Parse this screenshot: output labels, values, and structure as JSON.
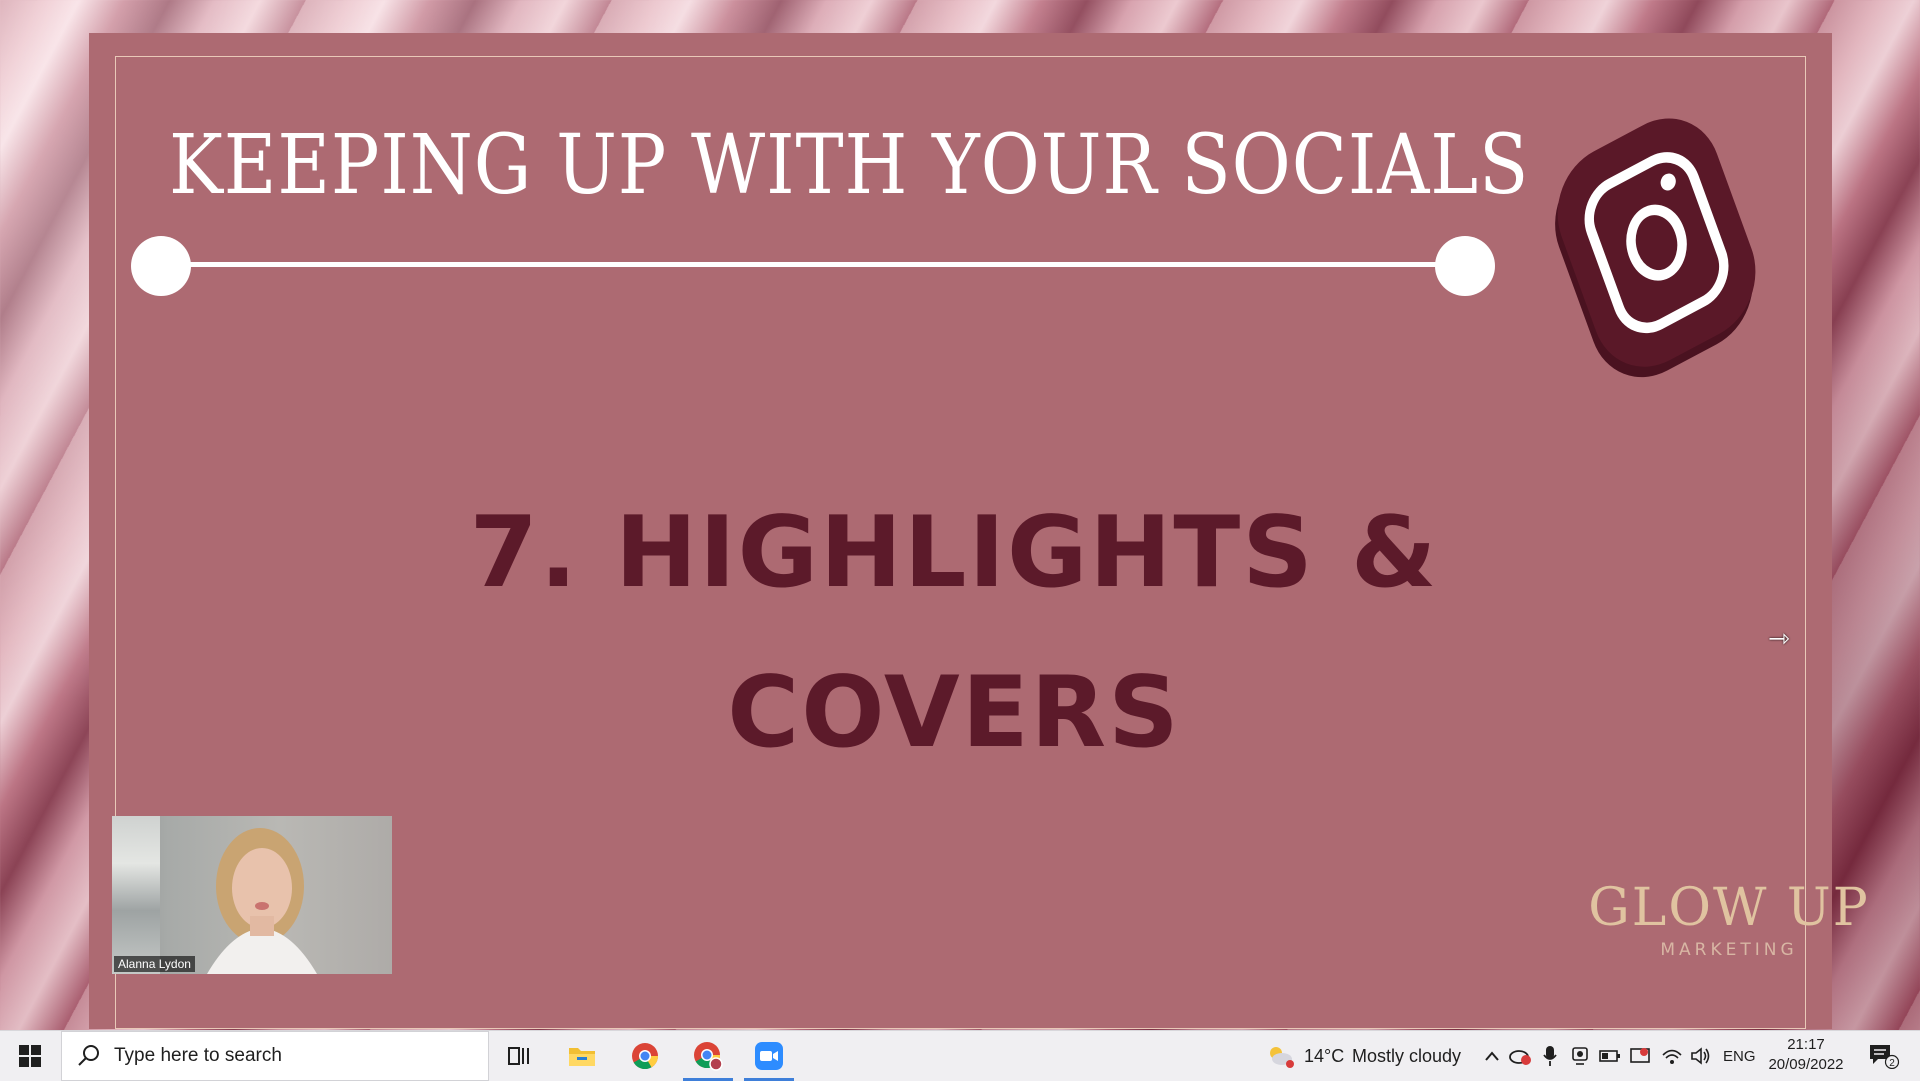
{
  "slide": {
    "title": "KEEPING UP WITH YOUR SOCIALS",
    "heading_line1": "7. HIGHLIGHTS &",
    "heading_line2": "COVERS",
    "brand_name": "GLOW UP",
    "brand_sub": "MARKETING",
    "icon": "instagram-icon",
    "colors": {
      "slide_bg": "#ad6a72",
      "heading": "#5c1a2a",
      "title": "#ffffff",
      "brand": "#e0c3a0",
      "icon": "#5a1828"
    }
  },
  "video": {
    "participant_name": "Alanna Lydon"
  },
  "taskbar": {
    "search_placeholder": "Type here to search",
    "apps": [
      "task-view-icon",
      "file-explorer-icon",
      "chrome-icon",
      "chrome-profile-icon",
      "zoom-icon"
    ],
    "active_apps": [
      "chrome-profile-icon",
      "zoom-icon"
    ],
    "weather_temp": "14°C",
    "weather_desc": "Mostly cloudy",
    "language": "ENG",
    "time": "21:17",
    "date": "20/09/2022",
    "notification_count": "2",
    "accent": "#3f7fd9"
  }
}
